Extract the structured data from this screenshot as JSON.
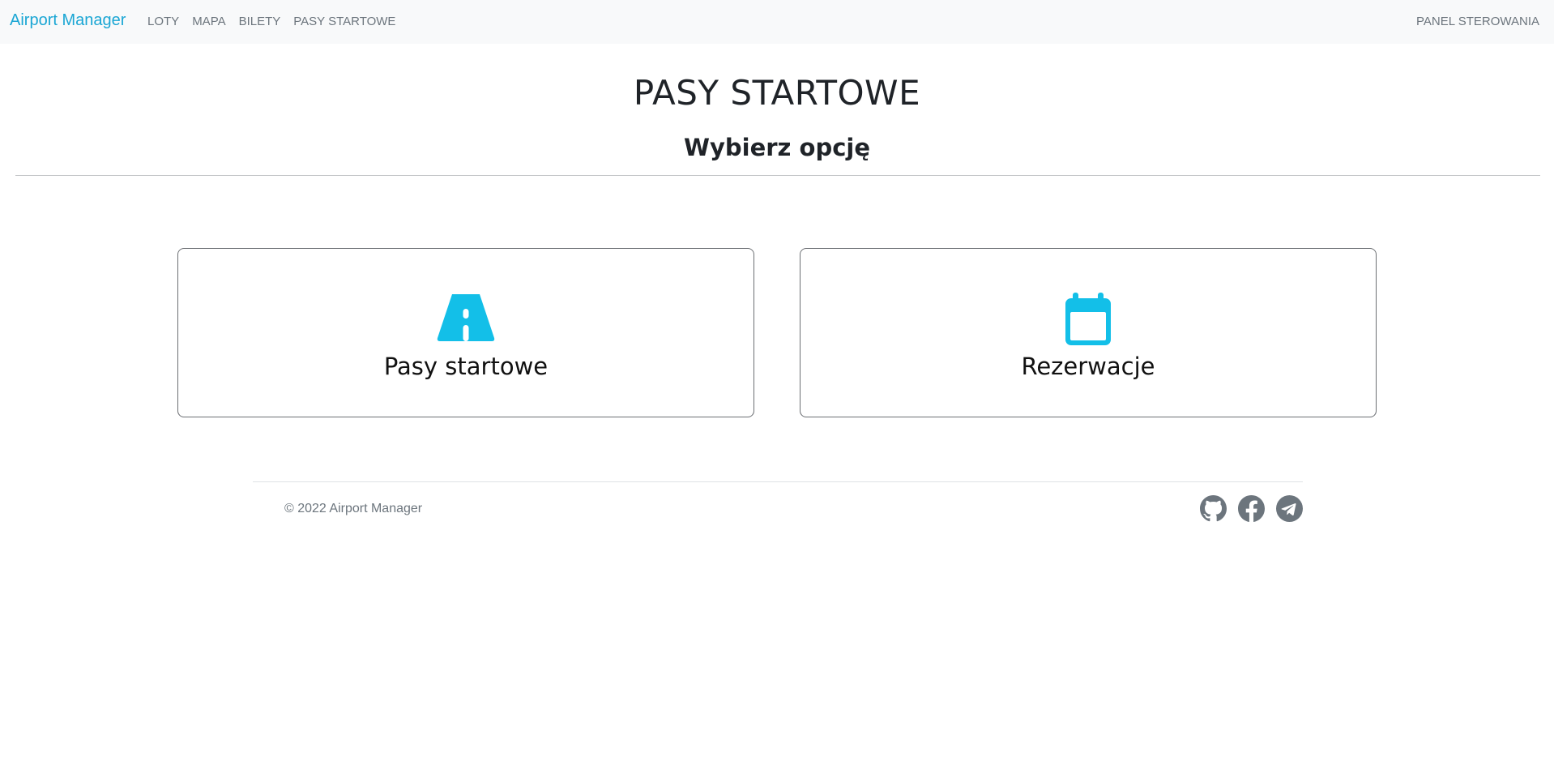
{
  "navbar": {
    "brand": "Airport Manager",
    "links": [
      "LOTY",
      "MAPA",
      "BILETY",
      "PASY STARTOWE"
    ],
    "right_link": "PANEL STEROWANIA"
  },
  "main": {
    "title": "PASY STARTOWE",
    "subtitle": "Wybierz opcję",
    "cards": [
      {
        "label": "Pasy startowe",
        "icon": "road-icon"
      },
      {
        "label": "Rezerwacje",
        "icon": "calendar-icon"
      }
    ]
  },
  "footer": {
    "copyright": "© 2022 Airport Manager",
    "social_icons": [
      "github-icon",
      "facebook-icon",
      "telegram-icon"
    ]
  },
  "colors": {
    "accent": "#1aa6d4",
    "icon_cyan": "#13bfe8",
    "muted": "#6c757d",
    "navbar_bg": "#f8f9fa"
  }
}
